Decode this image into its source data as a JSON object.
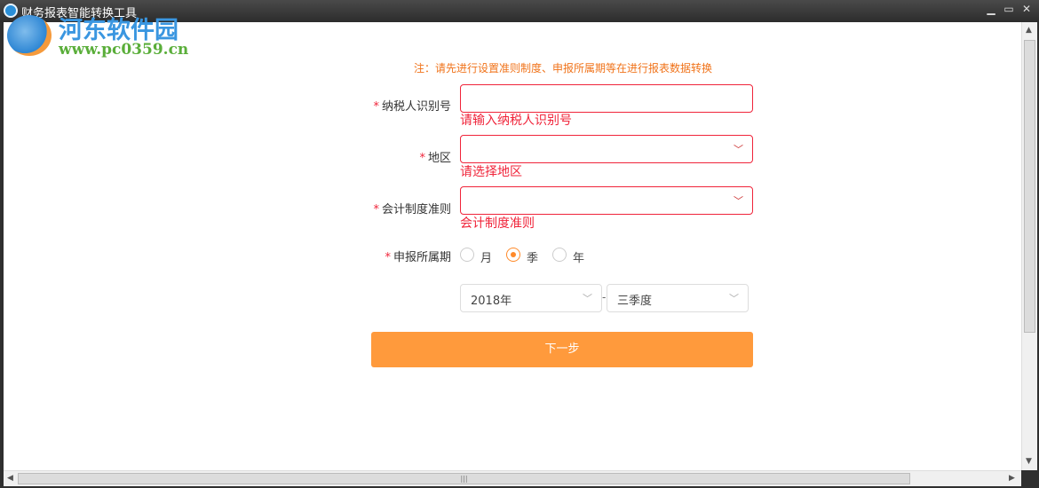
{
  "window": {
    "title": "财务报表智能转换工具",
    "minimize": "▁",
    "maximize": "▭",
    "close": "✕"
  },
  "watermark": {
    "name": "河东软件园",
    "url": "www.pc0359.cn"
  },
  "note": "注：请先进行设置准则制度、申报所属期等在进行报表数据转换",
  "form": {
    "taxpayer_id": {
      "label": "纳税人识别号",
      "value": "",
      "error": "请输入纳税人识别号"
    },
    "region": {
      "label": "地区",
      "value": "",
      "error": "请选择地区"
    },
    "accounting": {
      "label": "会计制度准则",
      "value": "",
      "error": "会计制度准则"
    },
    "period": {
      "label": "申报所属期",
      "options": [
        "月",
        "季",
        "年"
      ],
      "selected": "季"
    },
    "year": {
      "value": "2018年"
    },
    "separator": "-",
    "quarter": {
      "value": "三季度"
    },
    "required_mark": "*",
    "next_button": "下一步"
  },
  "scrollbar": {
    "grip": "|||"
  }
}
